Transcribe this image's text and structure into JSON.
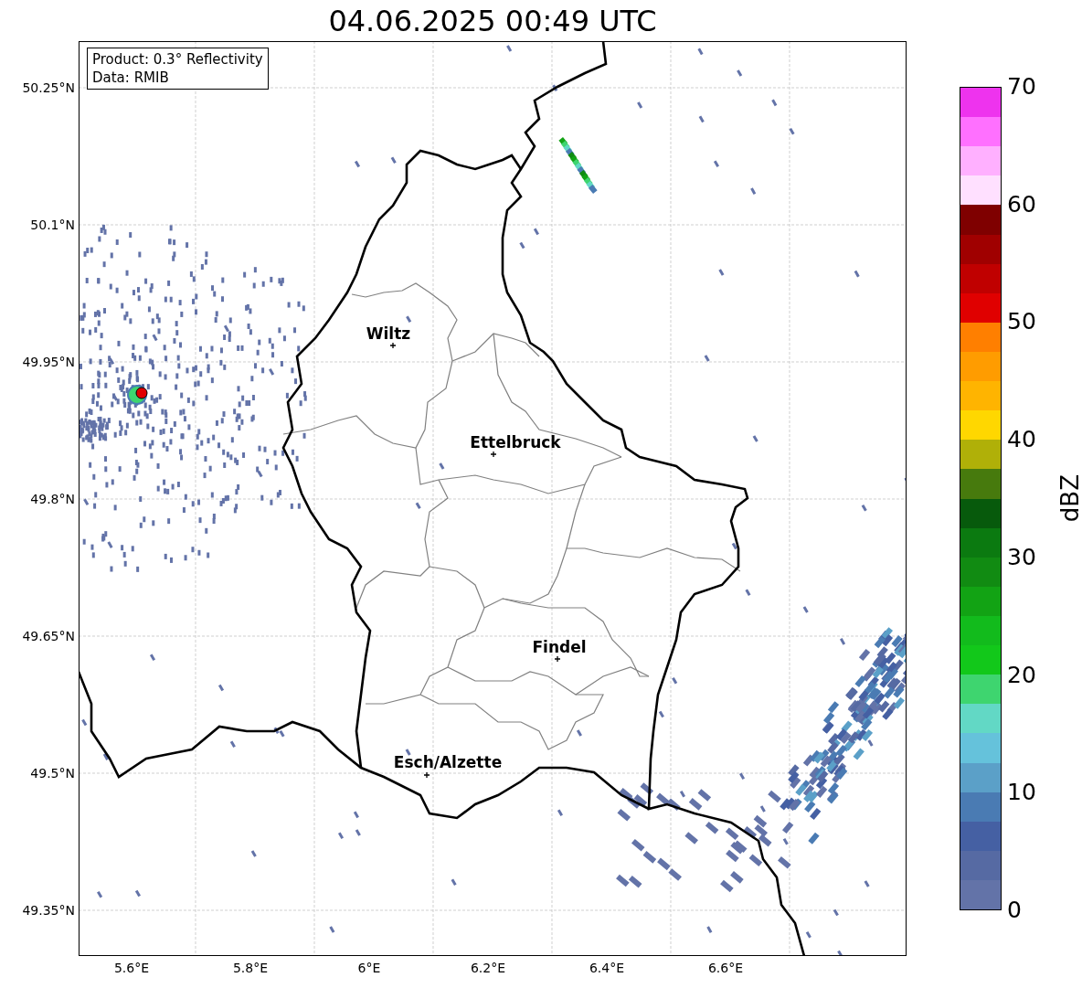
{
  "title": "04.06.2025 00:49 UTC",
  "info_box": [
    "Product: 0.3° Reflectivity",
    "Data: RMIB"
  ],
  "map": {
    "cities": [
      {
        "name": "Wiltz"
      },
      {
        "name": "Ettelbruck"
      },
      {
        "name": "Findel"
      },
      {
        "name": "Esch/Alzette"
      }
    ],
    "lat_labels": [
      "50.25°N",
      "50.1°N",
      "49.95°N",
      "49.8°N",
      "49.65°N",
      "49.5°N",
      "49.35°N"
    ],
    "lon_labels": [
      "5.6°E",
      "5.8°E",
      "6°E",
      "6.2°E",
      "6.4°E",
      "6.6°E"
    ]
  },
  "colorbar": {
    "label": "dBZ",
    "ticks": [
      "70",
      "60",
      "50",
      "40",
      "30",
      "20",
      "10",
      "0"
    ],
    "bands": [
      {
        "color": "#ee33ee"
      },
      {
        "color": "#ff70ff"
      },
      {
        "color": "#ffb0ff"
      },
      {
        "color": "#ffe0ff"
      },
      {
        "color": "#7f0000"
      },
      {
        "color": "#a00000"
      },
      {
        "color": "#c00000"
      },
      {
        "color": "#e00000"
      },
      {
        "color": "#ff7f00"
      },
      {
        "color": "#ff9c00"
      },
      {
        "color": "#ffb400"
      },
      {
        "color": "#ffd700"
      },
      {
        "color": "#b0b008"
      },
      {
        "color": "#477a0d"
      },
      {
        "color": "#075a0c"
      },
      {
        "color": "#0b7a10"
      },
      {
        "color": "#118b12"
      },
      {
        "color": "#12a314"
      },
      {
        "color": "#12bb1c"
      },
      {
        "color": "#12c81a"
      },
      {
        "color": "#3ed56f"
      },
      {
        "color": "#62d8c5"
      },
      {
        "color": "#65c2db"
      },
      {
        "color": "#5ba0c8"
      },
      {
        "color": "#4a7bb3"
      },
      {
        "color": "#4560a3"
      },
      {
        "color": "#566aa3"
      },
      {
        "color": "#6373a8"
      }
    ]
  }
}
